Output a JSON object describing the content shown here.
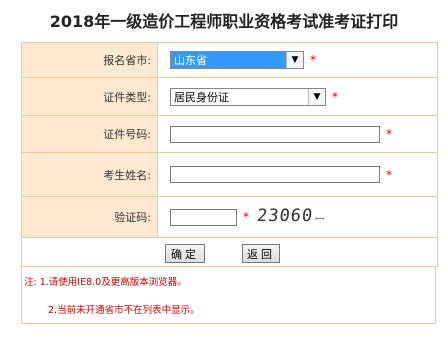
{
  "page": {
    "title": "2018年一级造价工程师职业资格考试准考证打印"
  },
  "form": {
    "province": {
      "label": "报名省市:",
      "value": "山东省",
      "star": "*"
    },
    "id_type": {
      "label": "证件类型:",
      "value": "居民身份证",
      "star": "*"
    },
    "id_number": {
      "label": "证件号码:",
      "value": "",
      "star": "*"
    },
    "name": {
      "label": "考生姓名:",
      "value": "",
      "star": "*"
    },
    "captcha": {
      "label": "验证码:",
      "value": "",
      "star": "*",
      "image_text": "23060",
      "image_suffix": "ꟷ"
    }
  },
  "buttons": {
    "confirm": "确定",
    "back": "返回"
  },
  "notes": {
    "line1": "注: 1.请使用IE8.0及更高版本浏览器。",
    "line2": "2.当前未开通省市不在列表中显示。"
  },
  "colors": {
    "label_bg": "#fde8d0",
    "border": "#f2c79d",
    "required": "#ee0000",
    "note_text": "#cc0000",
    "select_highlight": "#3399ff"
  }
}
